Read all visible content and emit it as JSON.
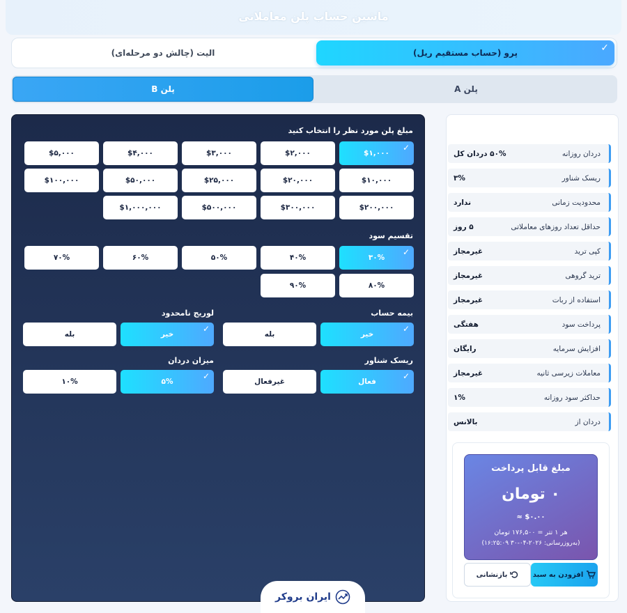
{
  "page": {
    "title": "ماشین حساب پلن معاملاتی"
  },
  "account_tabs": [
    {
      "label": "پرو (حساب مستقیم ریل)",
      "active": true
    },
    {
      "label": "الیت (چالش دو مرحله‌ای)",
      "active": false
    }
  ],
  "plan_tabs": [
    {
      "label": "پلن A",
      "active": false
    },
    {
      "label": "پلن B",
      "active": true
    }
  ],
  "options": {
    "amount_title": "مبلغ پلن مورد نظر را انتخاب کنید",
    "amounts": [
      "$۱,۰۰۰",
      "$۲,۰۰۰",
      "$۳,۰۰۰",
      "$۴,۰۰۰",
      "$۵,۰۰۰",
      "$۱۰,۰۰۰",
      "$۲۰,۰۰۰",
      "$۲۵,۰۰۰",
      "$۵۰,۰۰۰",
      "$۱۰۰,۰۰۰",
      "$۲۰۰,۰۰۰",
      "$۳۰۰,۰۰۰",
      "$۵۰۰,۰۰۰",
      "$۱,۰۰۰,۰۰۰"
    ],
    "split_title": "تقسیم سود",
    "splits": [
      "۳۰%",
      "۴۰%",
      "۵۰%",
      "۶۰%",
      "۷۰%",
      "۸۰%",
      "۹۰%"
    ],
    "insurance_title": "بیمه حساب",
    "insurance": [
      "خیر",
      "بله"
    ],
    "leverage_title": "لوریج نامحدود",
    "leverage": [
      "خیر",
      "بله"
    ],
    "floating_title": "ریسک شناور",
    "floating": [
      "فعال",
      "غیرفعال"
    ],
    "drawdown_title": "میزان دردان",
    "drawdown": [
      "۵%",
      "۱۰%"
    ]
  },
  "info": [
    {
      "label": "دردان روزانه",
      "value": "۵۰% دردان کل"
    },
    {
      "label": "ریسک شناور",
      "value": "۳%"
    },
    {
      "label": "محدودیت زمانی",
      "value": "ندارد"
    },
    {
      "label": "حداقل تعداد روزهای معاملاتی",
      "value": "۵ روز"
    },
    {
      "label": "کپی ترید",
      "value": "غیرمجاز"
    },
    {
      "label": "ترید گروهی",
      "value": "غیرمجاز"
    },
    {
      "label": "استفاده از ربات",
      "value": "غیرمجاز"
    },
    {
      "label": "پرداخت سود",
      "value": "هفتگی"
    },
    {
      "label": "افزایش سرمایه",
      "value": "رایگان"
    },
    {
      "label": "معاملات زیرسی ثانیه",
      "value": "غیرمجاز"
    },
    {
      "label": "حداکثر سود روزانه",
      "value": "۱%"
    },
    {
      "label": "دردان از",
      "value": "بالانس"
    }
  ],
  "payment": {
    "title": "مبلغ قابل پرداخت",
    "amount": "۰ تومان",
    "usd": "$۰.۰۰ ≈",
    "rate": "هر ۱ تتر = ۱۷۶,۵۰۰ تومان",
    "updated": "(به‌روزرسانی: ۲۰۲۶-۰۴-۳۰ ۱۶:۲۵:۰۹)",
    "add_label": "افزودن به سبد",
    "reset_label": "بازنشانی"
  },
  "brand": {
    "name": "ایران بروکر"
  },
  "icons": {
    "check": "check-icon",
    "cart": "cart-icon",
    "undo": "undo-icon",
    "logo": "trend-logo-icon"
  },
  "colors": {
    "accent": "#1ee0ff",
    "panel_dark": "#1c2a4a",
    "pay_purple": "#7a55ad"
  }
}
